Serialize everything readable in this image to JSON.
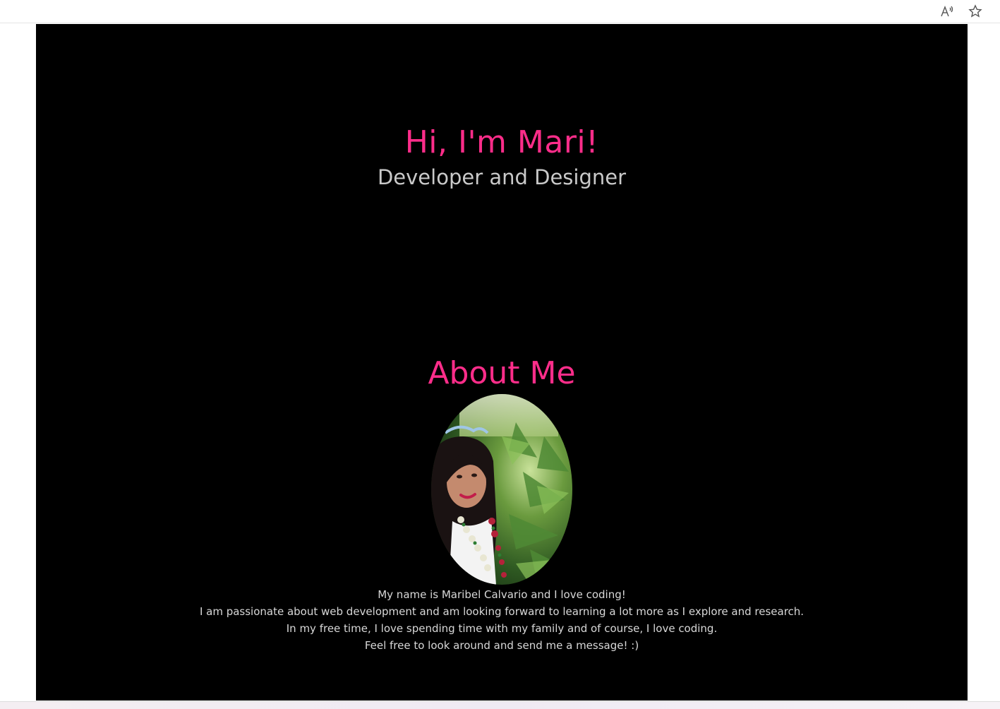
{
  "browser": {
    "icons": [
      "read-aloud-icon",
      "favorite-star-icon"
    ]
  },
  "hero": {
    "title": "Hi, I'm Mari!",
    "subtitle": "Developer and Designer"
  },
  "about": {
    "title": "About Me",
    "photo": "portrait-photo",
    "bio_lines": [
      "My name is Maribel Calvario and I love coding!",
      "I am passionate about web development and am looking forward to learning a lot more as I explore and research.",
      "In my free time, I love spending time with my family and of course, I love coding.",
      "Feel free to look around and send me a message! :)"
    ]
  },
  "colors": {
    "accent": "#ff2d8a",
    "subtitle": "#c9c9c9",
    "body_text": "#d8d8d8",
    "background": "#000000"
  }
}
